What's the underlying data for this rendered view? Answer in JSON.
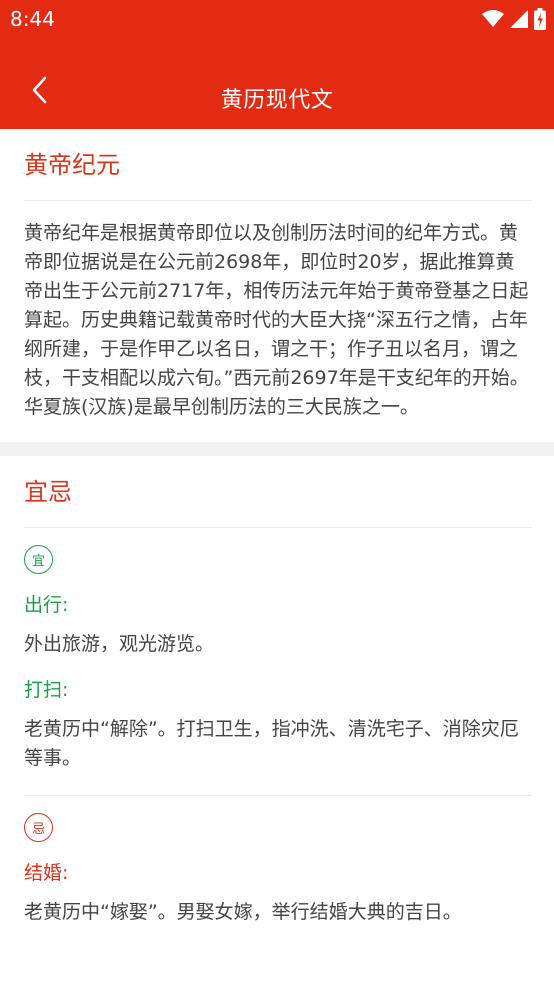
{
  "status_bar": {
    "time": "8:44",
    "icons": [
      "wifi-icon",
      "signal-icon",
      "battery-icon"
    ]
  },
  "header": {
    "title": "黄历现代文",
    "back_icon": "chevron-left-icon"
  },
  "colors": {
    "brand": "#e32a12",
    "accent_red": "#d9341c",
    "good_green": "#1aa04a"
  },
  "intro": {
    "title": "黄帝纪元",
    "text": "黄帝纪年是根据黄帝即位以及创制历法时间的纪年方式。黄帝即位据说是在公元前2698年，即位时20岁，据此推算黄帝出生于公元前2717年，相传历法元年始于黄帝登基之日起算起。历史典籍记载黄帝时代的大臣大挠“深五行之情，占年纲所建，于是作甲乙以名日，谓之干；作子丑以名月，谓之枝，干支相配以成六旬。”西元前2697年是干支纪年的开始。华夏族(汉族)是最早创制历法的三大民族之一。"
  },
  "yiji": {
    "title": "宜忌",
    "yi": {
      "badge": "宜",
      "items": [
        {
          "label": "出行:",
          "desc": "外出旅游，观光游览。"
        },
        {
          "label": "打扫:",
          "desc": "老黄历中“解除”。打扫卫生，指冲洗、清洗宅子、消除灾厄等事。"
        }
      ]
    },
    "ji": {
      "badge": "忌",
      "items": [
        {
          "label": "结婚:",
          "desc": "老黄历中“嫁娶”。男娶女嫁，举行结婚大典的吉日。"
        }
      ]
    }
  }
}
